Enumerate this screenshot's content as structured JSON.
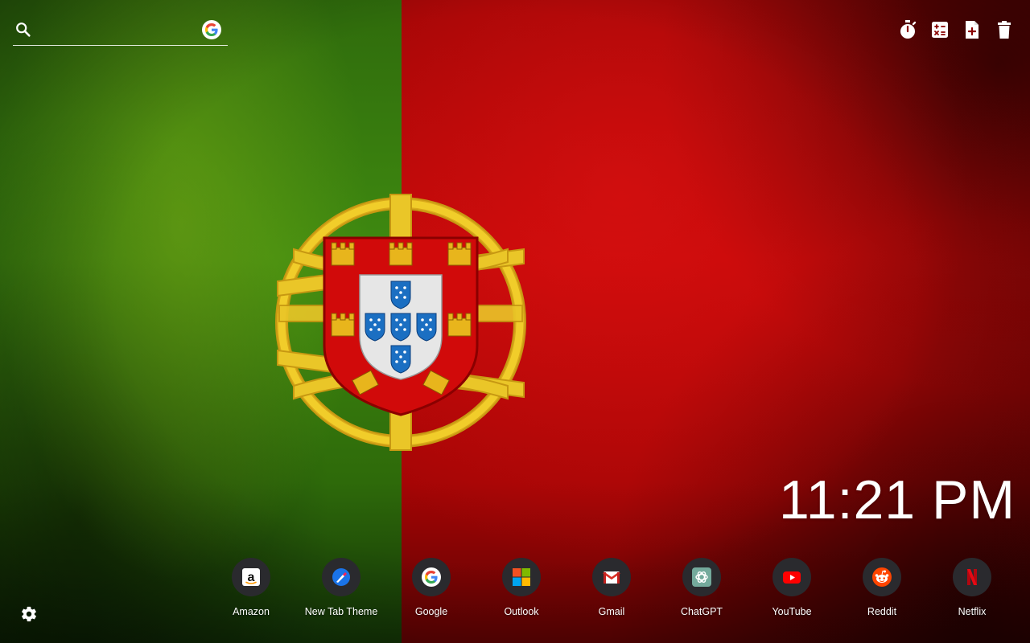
{
  "search": {
    "value": "",
    "placeholder": ""
  },
  "toolbar": {
    "icons": [
      "timer-icon",
      "calculator-icon",
      "new-note-icon",
      "trash-icon"
    ]
  },
  "clock": {
    "time": "11:21 PM"
  },
  "shortcuts": [
    {
      "label": "Amazon",
      "icon": "amazon-icon"
    },
    {
      "label": "New Tab Theme",
      "icon": "new-tab-theme-icon"
    },
    {
      "label": "Google",
      "icon": "google-icon"
    },
    {
      "label": "Outlook",
      "icon": "outlook-icon"
    },
    {
      "label": "Gmail",
      "icon": "gmail-icon"
    },
    {
      "label": "ChatGPT",
      "icon": "chatgpt-icon"
    },
    {
      "label": "YouTube",
      "icon": "youtube-icon"
    },
    {
      "label": "Reddit",
      "icon": "reddit-icon"
    },
    {
      "label": "Netflix",
      "icon": "netflix-icon"
    }
  ],
  "colors": {
    "flag_green": "#3f8a10",
    "flag_red": "#c00808",
    "emblem_gold": "#e8c21e",
    "shortcut_bubble": "#2a2a2e"
  }
}
